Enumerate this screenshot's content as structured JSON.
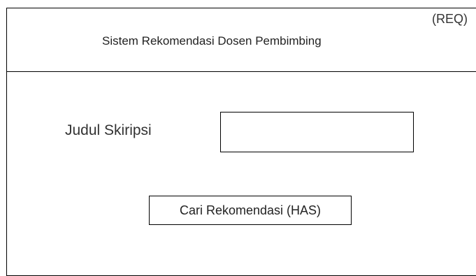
{
  "header": {
    "title": "Sistem Rekomendasi Dosen Pembimbing",
    "tag": "(REQ)"
  },
  "form": {
    "field_label": "Judul Skiripsi",
    "input_value": "",
    "input_placeholder": "",
    "button_label": "Cari Rekomendasi (HAS)"
  }
}
